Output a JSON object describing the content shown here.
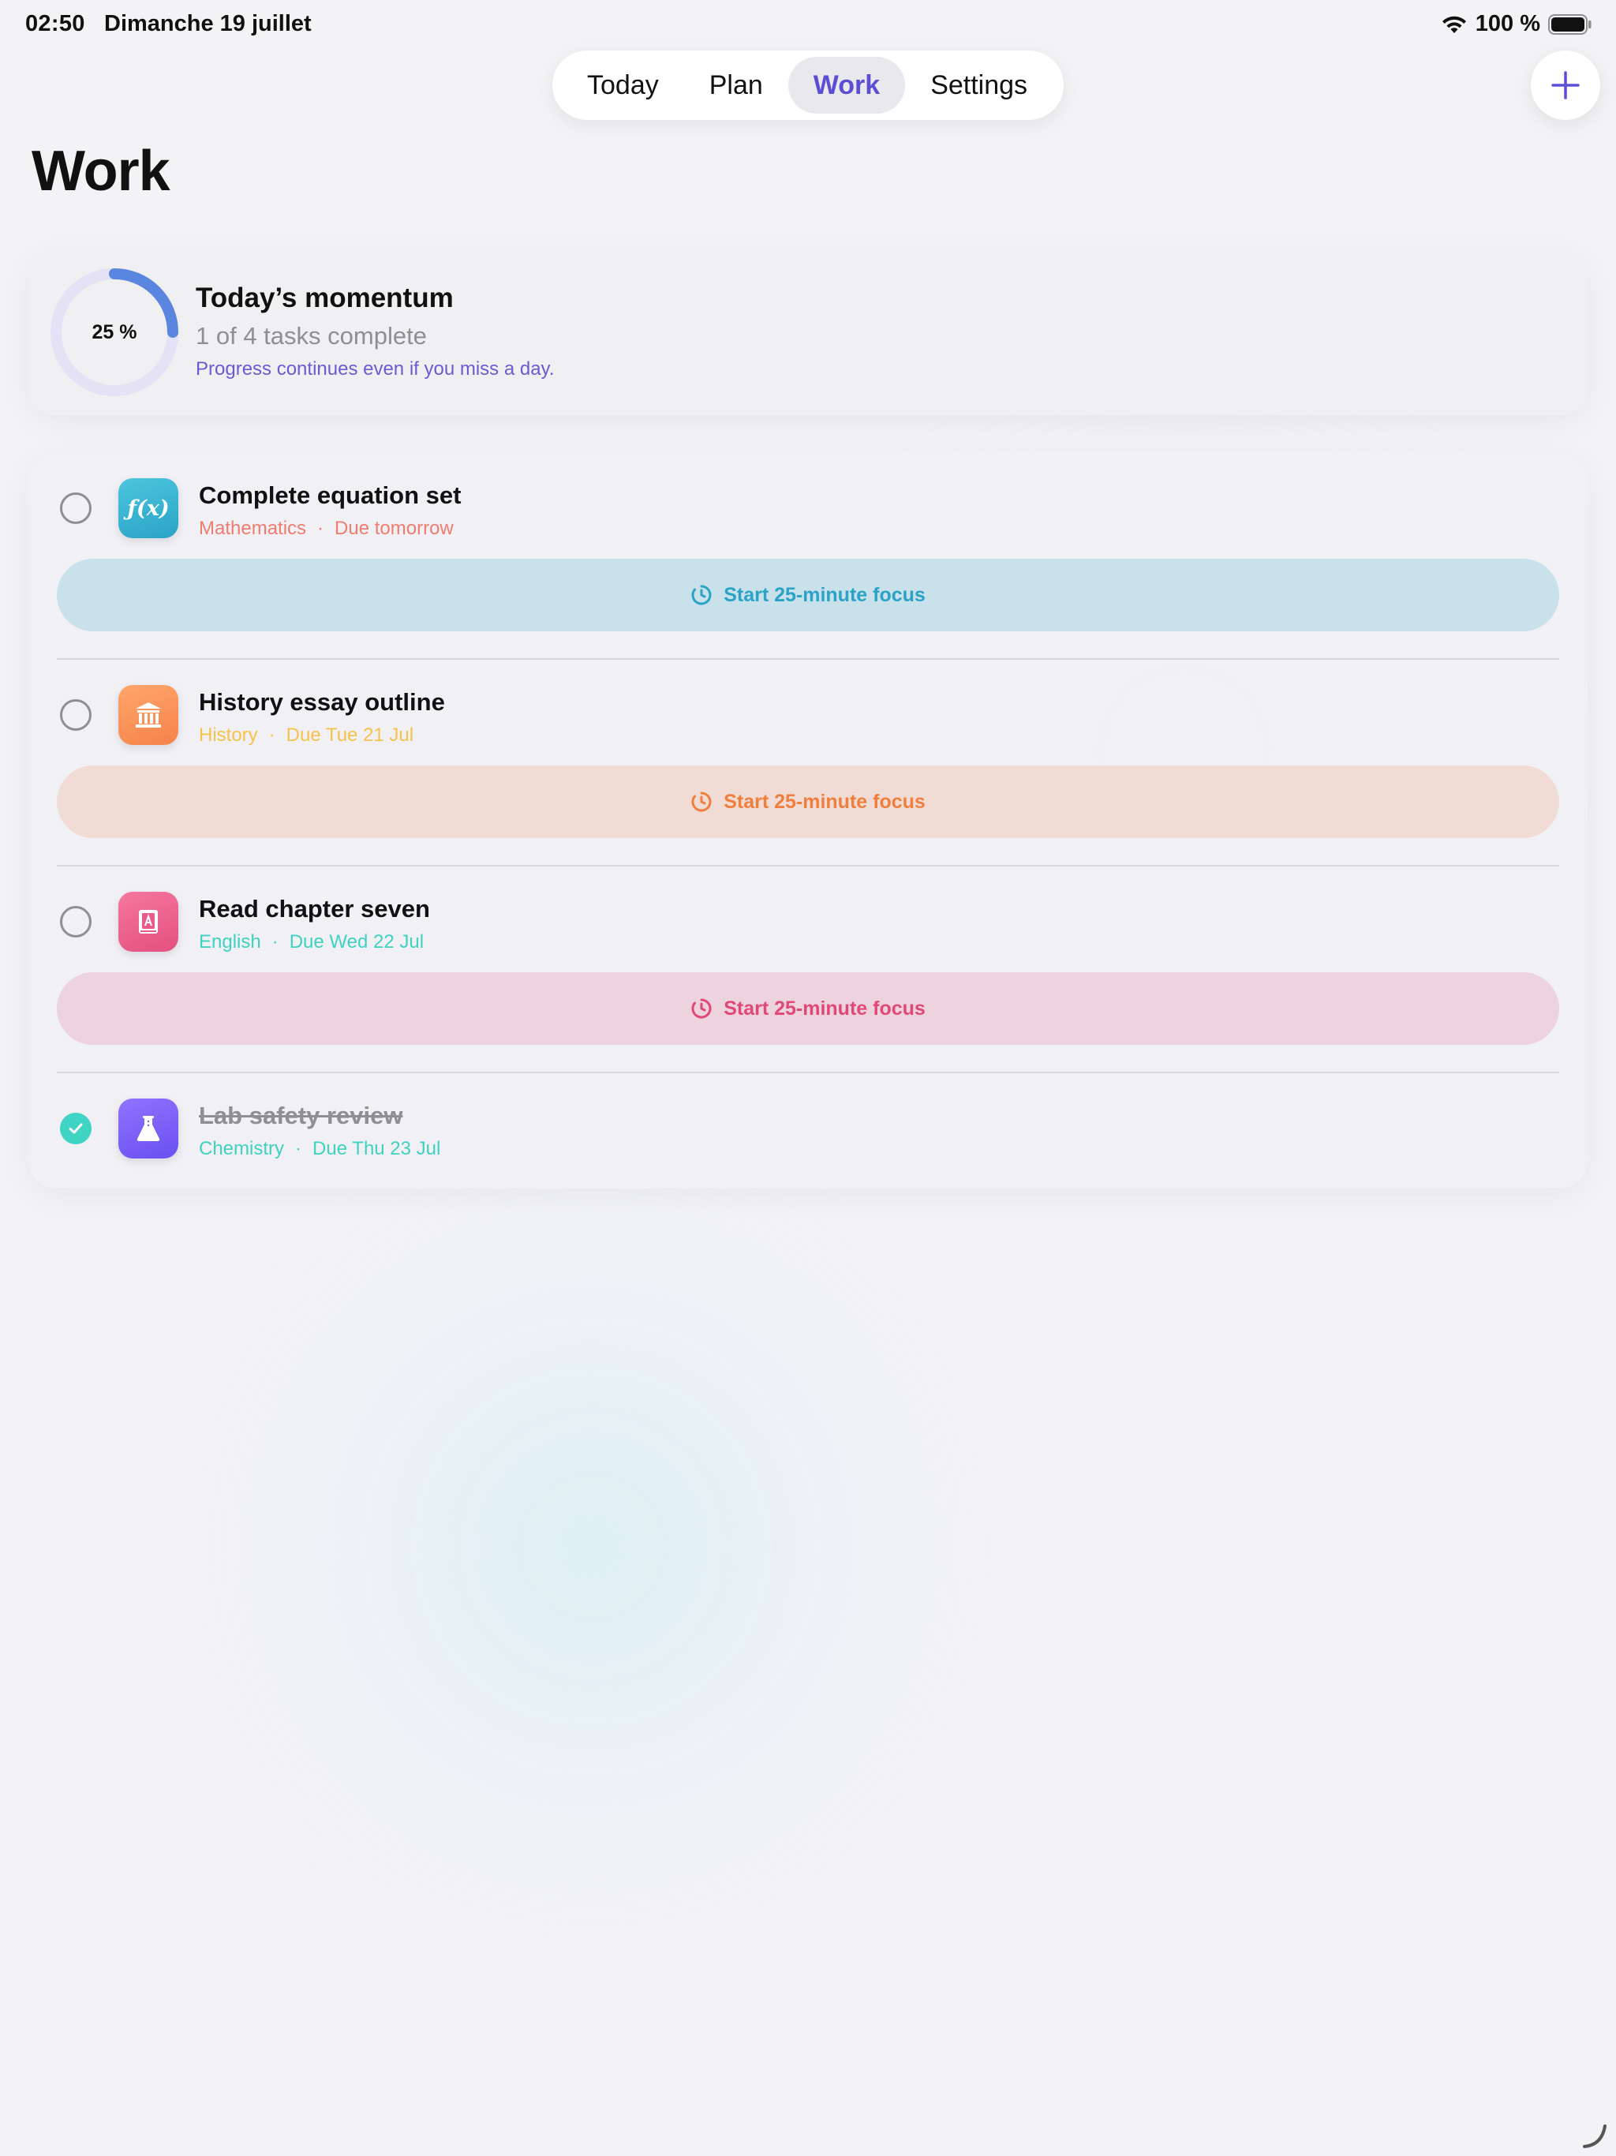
{
  "status_bar": {
    "time": "02:50",
    "date": "Dimanche 19 juillet",
    "battery": "100 %",
    "icons": [
      "wifi-icon",
      "battery-icon"
    ]
  },
  "nav": {
    "tabs": [
      {
        "label": "Today",
        "active": false
      },
      {
        "label": "Plan",
        "active": false
      },
      {
        "label": "Work",
        "active": true
      },
      {
        "label": "Settings",
        "active": false
      }
    ]
  },
  "header": {
    "title": "Work",
    "add_icon": "plus-icon"
  },
  "momentum": {
    "percent_label": "25 %",
    "progress": 0.25,
    "title": "Today’s momentum",
    "subtitle": "1 of 4 tasks complete",
    "note": "Progress continues even if you miss a day."
  },
  "tasks": [
    {
      "title": "Complete equation set",
      "subject": "Mathematics",
      "due": "Due tomorrow",
      "done": false,
      "icon": "function-icon",
      "focus_label": "Start 25-minute focus",
      "colors": {
        "accent": "#2aa3c7",
        "meta": "#f07c70",
        "focus_bg": "#c8e1ea",
        "icon_bg": "#35b7d2"
      }
    },
    {
      "title": "History essay outline",
      "subject": "History",
      "due": "Due Tue 21 Jul",
      "done": false,
      "icon": "museum-icon",
      "focus_label": "Start 25-minute focus",
      "colors": {
        "accent": "#f07f3e",
        "meta": "#f6c34a",
        "focus_bg": "#f0dcd4",
        "icon_bg": "#f99457"
      }
    },
    {
      "title": "Read chapter seven",
      "subject": "English",
      "due": "Due Wed 22 Jul",
      "done": false,
      "icon": "book-icon",
      "focus_label": "Start 25-minute focus",
      "colors": {
        "accent": "#e0487a",
        "meta": "#3fd1c1",
        "focus_bg": "#ecd3de",
        "icon_bg": "#ee6a95"
      }
    },
    {
      "title": "Lab safety review",
      "subject": "Chemistry",
      "due": "Due Thu 23 Jul",
      "done": true,
      "icon": "flask-icon",
      "colors": {
        "meta": "#3fd1c1",
        "icon_bg": "#7b5cf2"
      }
    }
  ],
  "colors": {
    "brand": "#5b4ed4",
    "ring_track": "#e4e2f4",
    "ring_fill": "#5a86df",
    "check_done": "#3fd4c4"
  }
}
